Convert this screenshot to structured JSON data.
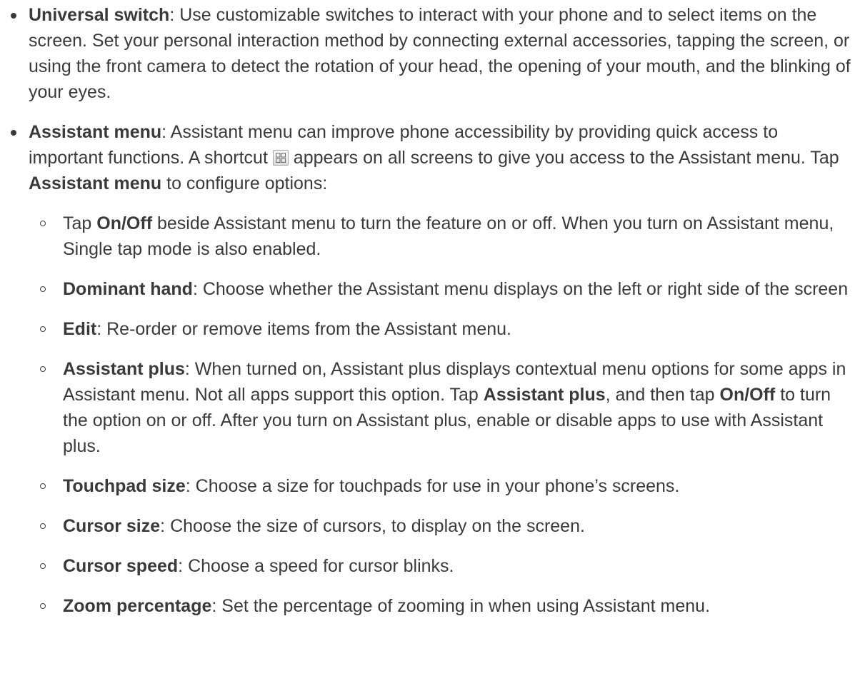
{
  "items": [
    {
      "term": "Universal switch",
      "text": ": Use customizable switches to interact with your phone and to select items on the screen. Set your personal interaction method by connecting external accessories, tapping the screen, or using the front camera to detect the rotation of your head, the opening of your mouth, and the blinking of your eyes."
    },
    {
      "term": "Assistant menu",
      "text_before_icon": ": Assistant menu can improve phone accessibility by providing quick access to important functions. A shortcut ",
      "icon": "assistant-menu-grid-icon",
      "text_after_icon": " appears on all screens to give you access to the Assistant menu. Tap ",
      "tap_term": "Assistant menu",
      "text_end": " to configure options:",
      "subitems": [
        {
          "pre": "Tap ",
          "term": "On/Off",
          "text": " beside Assistant menu to turn the feature on or off. When you turn on Assistant menu, Single tap mode is also enabled."
        },
        {
          "term": "Dominant hand",
          "text": ": Choose whether the Assistant menu displays on the left or right side of the screen"
        },
        {
          "term": "Edit",
          "text": ": Re-order or remove items from the Assistant menu."
        },
        {
          "term": "Assistant plus",
          "text1": ": When turned on, Assistant plus displays contextual menu options for some apps in Assistant menu. Not all apps support this option. Tap ",
          "term2": "Assistant plus",
          "text2": ", and then tap ",
          "term3": "On/Off",
          "text3": " to turn the option on or off. After you turn on Assistant plus, enable or disable apps to use with Assistant plus."
        },
        {
          "term": "Touchpad size",
          "text": ": Choose a size for touchpads for use in your phone’s screens."
        },
        {
          "term": "Cursor size",
          "text": ": Choose the size of cursors, to display on the screen."
        },
        {
          "term": "Cursor speed",
          "text": ": Choose a speed for cursor blinks."
        },
        {
          "term": "Zoom percentage",
          "text": ": Set the percentage of zooming in when using Assistant menu."
        }
      ]
    }
  ]
}
